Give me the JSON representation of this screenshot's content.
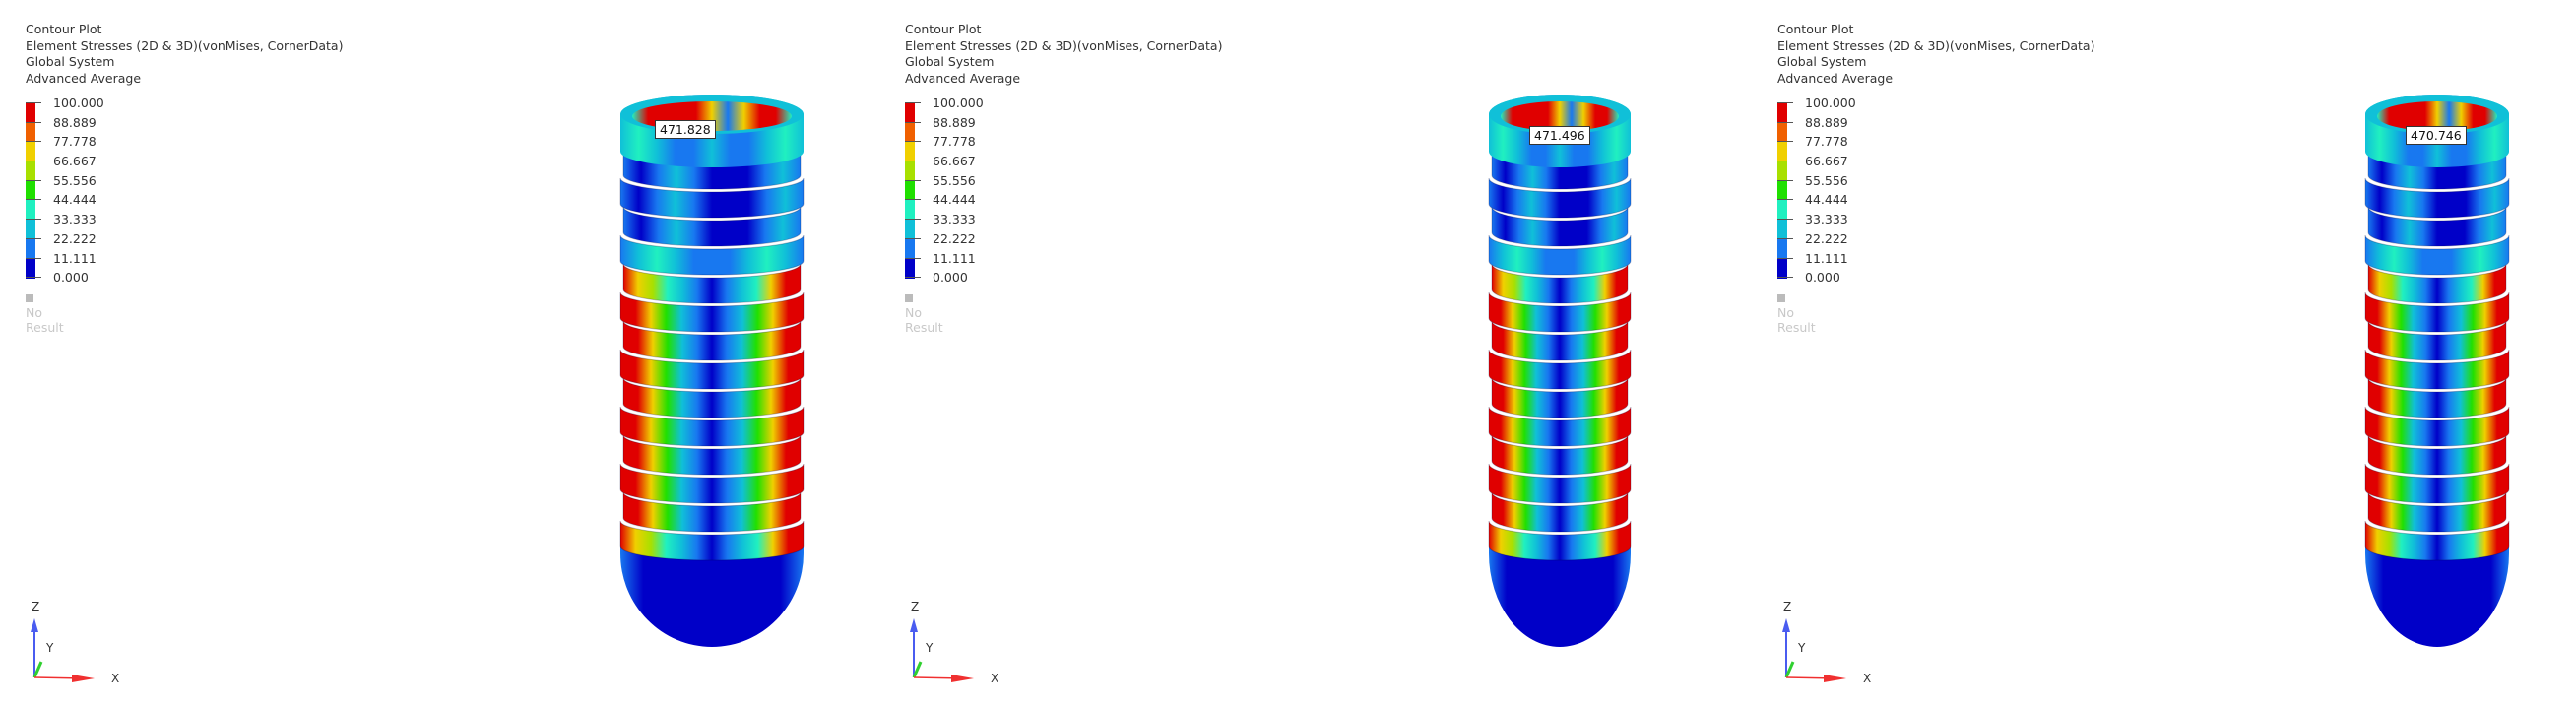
{
  "legend_colors": [
    "#e00000",
    "#f06000",
    "#f0d000",
    "#a8e000",
    "#20e000",
    "#20f0c0",
    "#10c0d8",
    "#1878f0",
    "#0000c8"
  ],
  "legend_values": [
    "100.000",
    "88.889",
    "77.778",
    "66.667",
    "55.556",
    "44.444",
    "33.333",
    "22.222",
    "11.111",
    "0.000"
  ],
  "panels": [
    {
      "title": "Contour Plot",
      "subtitle": "Element Stresses (2D & 3D)(vonMises, CornerData)",
      "system": "Global System",
      "averaging": "Advanced Average",
      "no_result": "No Result",
      "max_label": "471.828",
      "axes": {
        "x": "X",
        "y": "Y",
        "z": "Z"
      }
    },
    {
      "title": "Contour Plot",
      "subtitle": "Element Stresses (2D & 3D)(vonMises, CornerData)",
      "system": "Global System",
      "averaging": "Advanced Average",
      "no_result": "No Result",
      "max_label": "471.496",
      "axes": {
        "x": "X",
        "y": "Y",
        "z": "Z"
      }
    },
    {
      "title": "Contour Plot",
      "subtitle": "Element Stresses (2D & 3D)(vonMises, CornerData)",
      "system": "Global System",
      "averaging": "Advanced Average",
      "no_result": "No Result",
      "max_label": "470.746",
      "axes": {
        "x": "X",
        "y": "Y",
        "z": "Z"
      }
    }
  ]
}
